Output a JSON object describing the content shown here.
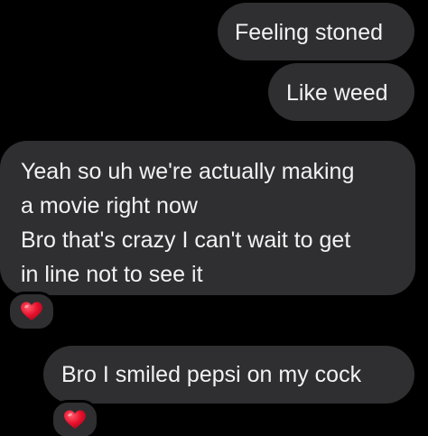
{
  "messages": [
    {
      "lines": [
        "Feeling stoned"
      ]
    },
    {
      "lines": [
        "Like weed"
      ]
    },
    {
      "lines": [
        "Yeah so uh we're actually making",
        "a movie right now",
        "Bro that's crazy I can't wait to get",
        "in line not to see it"
      ]
    },
    {
      "lines": [
        "Bro I smiled pepsi on my cock"
      ]
    }
  ],
  "reactions": [
    {
      "icon": "heart-icon",
      "color": "#e8112d"
    },
    {
      "icon": "heart-icon",
      "color": "#e8112d"
    }
  ],
  "colors": {
    "background": "#000000",
    "bubble": "#2f2f31",
    "text": "#f2f2f2",
    "heart": "#e8112d"
  }
}
